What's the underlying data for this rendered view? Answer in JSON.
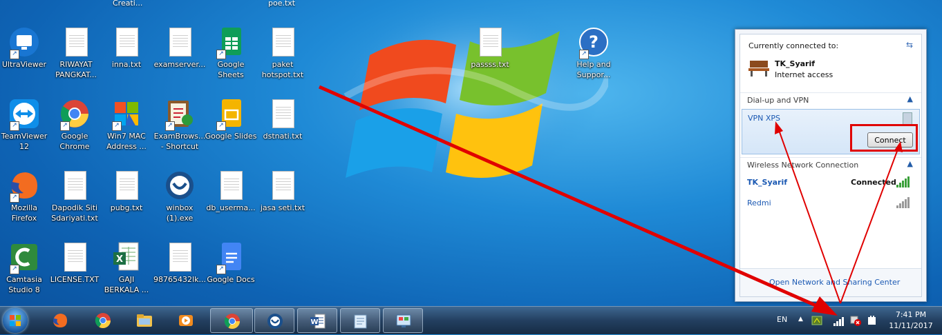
{
  "desktop": {
    "top_labels": [
      "Creati...",
      "poe.txt"
    ],
    "icons": [
      {
        "label": "UltraViewer"
      },
      {
        "label": "RIWAYAT\nPANGKAT..."
      },
      {
        "label": "inna.txt"
      },
      {
        "label": "examserver..."
      },
      {
        "label": "Google\nSheets"
      },
      {
        "label": "paket\nhotspot.txt"
      },
      {
        "label": "passss.txt"
      },
      {
        "label": "Help and\nSuppor..."
      },
      {
        "label": "TeamViewer\n12"
      },
      {
        "label": "Google\nChrome"
      },
      {
        "label": "Win7 MAC\nAddress ..."
      },
      {
        "label": "ExamBrows...\n- Shortcut"
      },
      {
        "label": "Google Slides"
      },
      {
        "label": "dstnati.txt"
      },
      {
        "label": "Mozilla\nFirefox"
      },
      {
        "label": "Dapodik Siti\nSdariyati.txt"
      },
      {
        "label": "pubg.txt"
      },
      {
        "label": "winbox\n(1).exe"
      },
      {
        "label": "db_userma..."
      },
      {
        "label": "jasa seti.txt"
      },
      {
        "label": "Camtasia\nStudio 8"
      },
      {
        "label": "LICENSE.TXT"
      },
      {
        "label": "GAJI\nBERKALA ..."
      },
      {
        "label": "98765432lk..."
      },
      {
        "label": "Google Docs"
      }
    ]
  },
  "network_popup": {
    "connected_heading": "Currently connected to:",
    "current_network": "TK_Syarif",
    "current_status": "Internet access",
    "section_dialup": "Dial-up and VPN",
    "vpn_name": "VPN XPS",
    "connect_button": "Connect",
    "section_wireless": "Wireless Network Connection",
    "wifi": [
      {
        "name": "TK_Syarif",
        "status": "Connected"
      },
      {
        "name": "Redmi",
        "status": ""
      }
    ],
    "footer_link": "Open Network and Sharing Center"
  },
  "taskbar": {
    "language": "EN",
    "tray_expand": "▲",
    "time": "7:41 PM",
    "date": "11/11/2017",
    "pinned": [
      "start",
      "firefox",
      "chrome",
      "explorer",
      "media-player",
      "chrome",
      "winbox",
      "word",
      "notepad",
      "control-panel"
    ]
  },
  "colors": {
    "annotation": "#e00000",
    "link": "#1b59b3"
  }
}
